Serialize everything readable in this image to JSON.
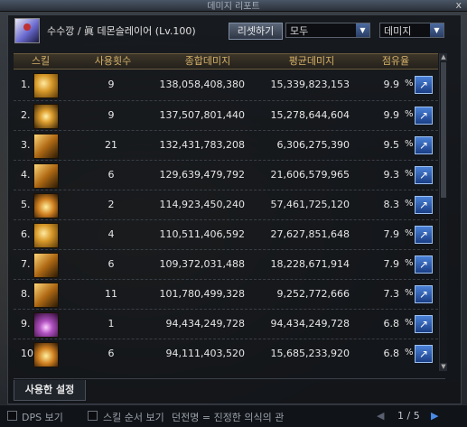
{
  "window": {
    "title": "데미지 리포트",
    "close_glyph": "x"
  },
  "character": {
    "name": "수수깡 / 眞 데몬슬레이어 (Lv.100)"
  },
  "controls": {
    "reset_label": "리셋하기",
    "filter_value": "모두",
    "metric_value": "데미지",
    "dropdown_arrow": "▼"
  },
  "table": {
    "headers": [
      "스킬",
      "사용횟수",
      "종합데미지",
      "평균데미지",
      "점유율"
    ],
    "rows": [
      {
        "rank": "1.",
        "count": "9",
        "total": "138,058,408,380",
        "avg": "15,339,823,153",
        "share": "9.9"
      },
      {
        "rank": "2.",
        "count": "9",
        "total": "137,507,801,440",
        "avg": "15,278,644,604",
        "share": "9.9"
      },
      {
        "rank": "3.",
        "count": "21",
        "total": "132,431,783,208",
        "avg": "6,306,275,390",
        "share": "9.5"
      },
      {
        "rank": "4.",
        "count": "6",
        "total": "129,639,479,792",
        "avg": "21,606,579,965",
        "share": "9.3"
      },
      {
        "rank": "5.",
        "count": "2",
        "total": "114,923,450,240",
        "avg": "57,461,725,120",
        "share": "8.3"
      },
      {
        "rank": "6.",
        "count": "4",
        "total": "110,511,406,592",
        "avg": "27,627,851,648",
        "share": "7.9"
      },
      {
        "rank": "7.",
        "count": "6",
        "total": "109,372,031,488",
        "avg": "18,228,671,914",
        "share": "7.9"
      },
      {
        "rank": "8.",
        "count": "11",
        "total": "101,780,499,328",
        "avg": "9,252,772,666",
        "share": "7.3"
      },
      {
        "rank": "9.",
        "count": "1",
        "total": "94,434,249,728",
        "avg": "94,434,249,728",
        "share": "6.8"
      },
      {
        "rank": "10.",
        "count": "6",
        "total": "94,111,403,520",
        "avg": "15,685,233,920",
        "share": "6.8"
      }
    ],
    "percent_sign": "%"
  },
  "scroll": {
    "up": "▲",
    "down": "▼"
  },
  "tabs": {
    "used_settings": "사용한 설정"
  },
  "footer": {
    "dps_label": "DPS 보기",
    "skill_order_label": "스킬 순서 보기",
    "dungeon_label": "던전명 = 진정한 의식의 관",
    "prev": "◀",
    "page": "1 / 5",
    "next": "▶"
  }
}
